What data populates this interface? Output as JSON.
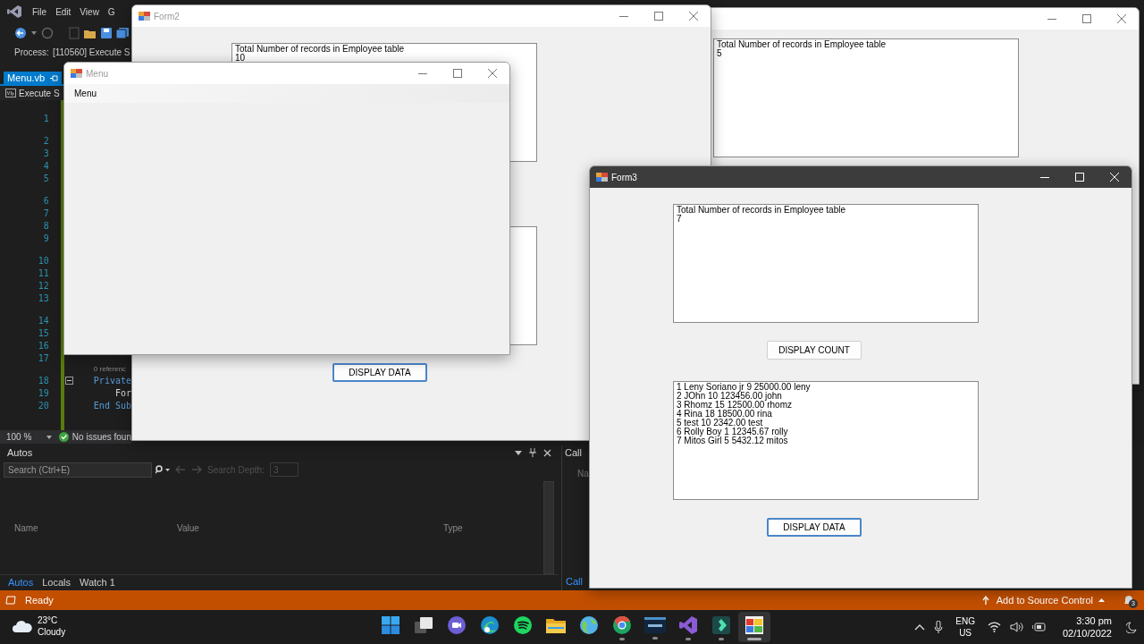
{
  "ide": {
    "menu": [
      "File",
      "Edit",
      "View",
      "G"
    ],
    "process": {
      "label": "Process:",
      "value": "[110560] Execute S"
    },
    "document_tab": {
      "label": "Menu.vb",
      "selected": true
    },
    "navigation": "Execute S",
    "editor_rows": [
      {
        "kind": "lens"
      },
      {
        "kind": "line",
        "number": "1"
      },
      {
        "kind": "lens"
      },
      {
        "kind": "line",
        "number": "2"
      },
      {
        "kind": "line",
        "number": "3"
      },
      {
        "kind": "line",
        "number": "4"
      },
      {
        "kind": "line",
        "number": "5"
      },
      {
        "kind": "lens"
      },
      {
        "kind": "line",
        "number": "6"
      },
      {
        "kind": "line",
        "number": "7"
      },
      {
        "kind": "line",
        "number": "8"
      },
      {
        "kind": "line",
        "number": "9"
      },
      {
        "kind": "lens"
      },
      {
        "kind": "line",
        "number": "10"
      },
      {
        "kind": "line",
        "number": "11"
      },
      {
        "kind": "line",
        "number": "12"
      },
      {
        "kind": "line",
        "number": "13"
      },
      {
        "kind": "lens"
      },
      {
        "kind": "line",
        "number": "14"
      },
      {
        "kind": "line",
        "number": "15"
      },
      {
        "kind": "line",
        "number": "16"
      },
      {
        "kind": "line",
        "number": "17"
      },
      {
        "kind": "lens",
        "text": "0 referenc"
      },
      {
        "kind": "line",
        "number": "18",
        "code": "Private",
        "keyword": true,
        "collapsible": true
      },
      {
        "kind": "line",
        "number": "19",
        "code": "    For",
        "keyword": false,
        "collapsible": false
      },
      {
        "kind": "line",
        "number": "20",
        "code": "End Sub",
        "keyword": true,
        "collapsible": false
      }
    ],
    "zoom": "100 %",
    "issues": "No issues foun"
  },
  "autos_panel": {
    "title": "Autos",
    "search": {
      "placeholder": "Search (Ctrl+E)"
    },
    "search_depth": {
      "label": "Search Depth:",
      "value": "3",
      "disabled": true
    },
    "columns": [
      "Name",
      "Value",
      "Type"
    ],
    "tabs": [
      {
        "label": "Autos",
        "selected": true
      },
      {
        "label": "Locals",
        "selected": false
      },
      {
        "label": "Watch 1",
        "selected": false
      }
    ]
  },
  "call_stack_panel": {
    "title": "Call",
    "column": "Na",
    "tab": {
      "label": "Call",
      "selected": true
    }
  },
  "windows": [
    {
      "active": false,
      "controls": [
        {
          "kind": "textbox",
          "lines": [
            "Total Number of records in Employee table",
            "5"
          ]
        }
      ]
    },
    {
      "title": "Form2",
      "active": false,
      "controls": [
        {
          "kind": "textbox",
          "lines": [
            "Total Number of records in Employee table",
            "10"
          ]
        },
        {
          "kind": "textbox"
        },
        {
          "kind": "button",
          "label": "DISPLAY DATA",
          "focused": true
        }
      ]
    },
    {
      "title": "Menu",
      "active": false,
      "menu": [
        "Menu"
      ]
    },
    {
      "title": "Form3",
      "active": true,
      "controls": [
        {
          "kind": "textbox",
          "lines": [
            "Total Number of records in Employee table",
            "7"
          ]
        },
        {
          "kind": "button",
          "label": "DISPLAY COUNT",
          "focused": false
        },
        {
          "kind": "textbox",
          "lines": [
            "1 Leny Soriano jr 9 25000.00 leny",
            "2 JOhn 10 123456.00 john",
            "3 Rhomz 15 12500.00 rhomz",
            "4 Rina 18 18500.00 rina",
            "5 test 10 2342.00 test",
            "6 Rolly Boy 1 12345.67 rolly",
            "7 Mitos Girl 5 5432.12 mitos"
          ]
        },
        {
          "kind": "button",
          "label": "DISPLAY DATA",
          "focused": true
        }
      ]
    }
  ],
  "status_bar": {
    "text": "Ready",
    "source_control": "Add to Source Control",
    "notification_count": "3"
  },
  "taskbar": {
    "weather": {
      "temperature": "23°C",
      "condition": "Cloudy"
    },
    "apps": [
      {
        "kind": "start",
        "running": false,
        "selected": false
      },
      {
        "kind": "taskview",
        "running": false,
        "selected": false
      },
      {
        "kind": "chat",
        "running": false,
        "selected": false
      },
      {
        "kind": "edge",
        "running": false,
        "selected": false
      },
      {
        "kind": "music",
        "running": false,
        "selected": false
      },
      {
        "kind": "folder",
        "running": false,
        "selected": false
      },
      {
        "kind": "globe",
        "running": false,
        "selected": false
      },
      {
        "kind": "browser",
        "running": true,
        "selected": false
      },
      {
        "kind": "database",
        "running": true,
        "selected": false
      },
      {
        "kind": "ide",
        "running": true,
        "selected": false
      },
      {
        "kind": "editor",
        "running": true,
        "selected": false
      },
      {
        "kind": "form",
        "running": true,
        "selected": true
      }
    ],
    "language": "ENG",
    "region": "US",
    "time": "3:30 pm",
    "date": "02/10/2022"
  }
}
